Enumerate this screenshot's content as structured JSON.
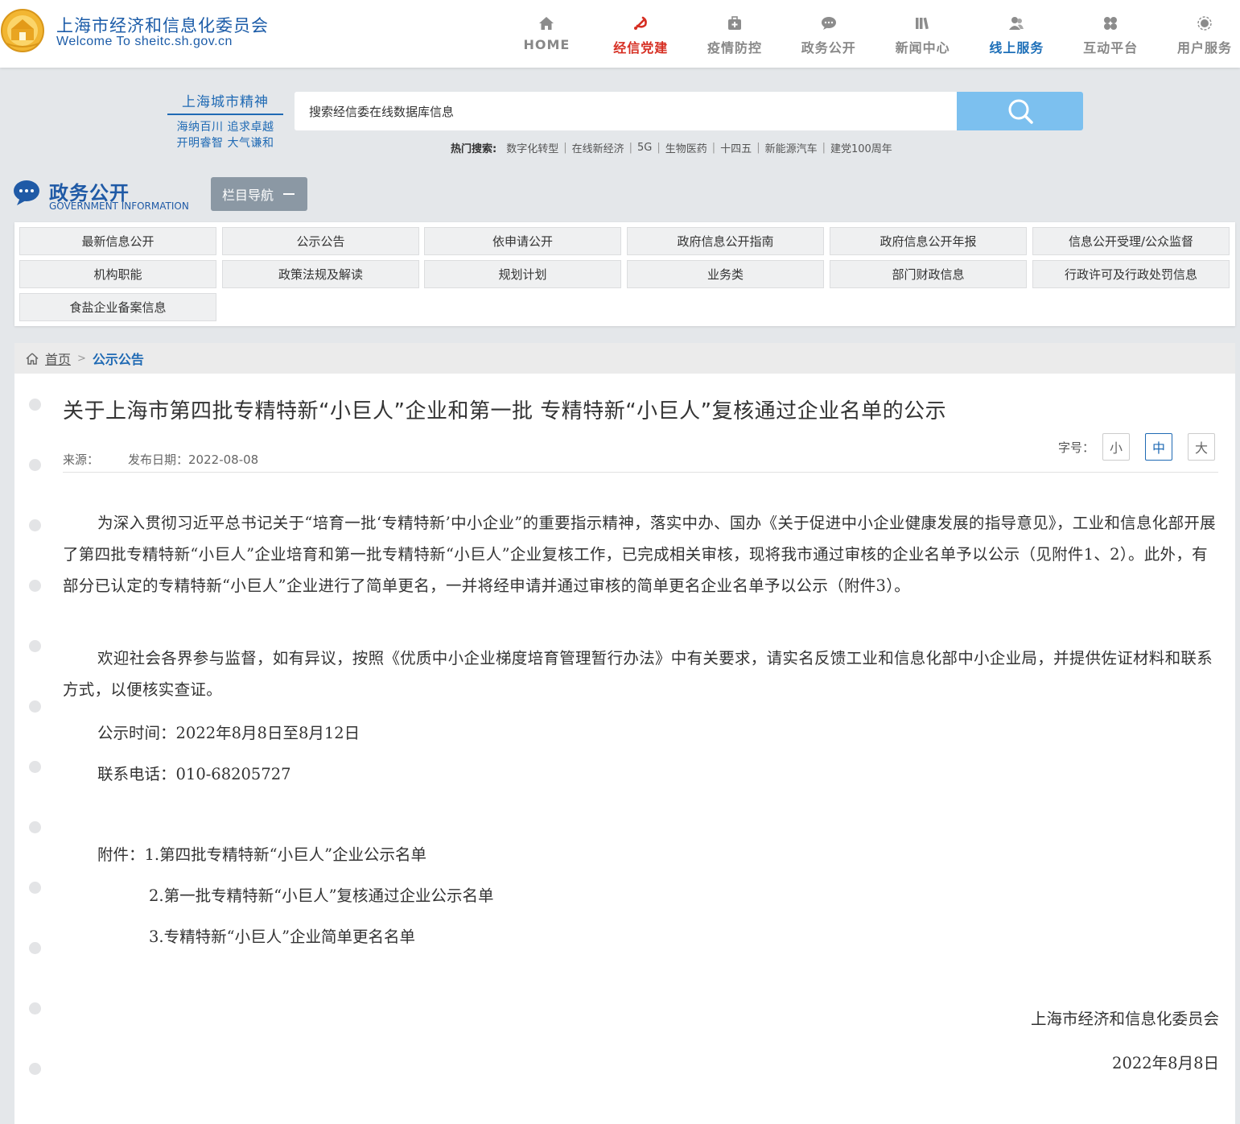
{
  "header": {
    "site_name": "上海市经济和信息化委员会",
    "site_sub": "Welcome  To  sheitc.sh.gov.cn",
    "nav": [
      {
        "label": "HOME",
        "icon": "home-icon"
      },
      {
        "label": "经信党建",
        "icon": "party-emblem-icon"
      },
      {
        "label": "疫情防控",
        "icon": "medical-kit-icon"
      },
      {
        "label": "政务公开",
        "icon": "chat-bubble-icon"
      },
      {
        "label": "新闻中心",
        "icon": "books-icon"
      },
      {
        "label": "线上服务",
        "icon": "users-icon"
      },
      {
        "label": "互动平台",
        "icon": "clover-icon"
      },
      {
        "label": "用户服务",
        "icon": "user-service-icon"
      }
    ]
  },
  "slogan": {
    "title": "上海城市精神",
    "line1": "海纳百川 追求卓越",
    "line2": "开明睿智 大气谦和"
  },
  "search": {
    "value": "搜索经信委在线数据库信息",
    "hot_label": "热门搜索:",
    "hot_items": [
      "数字化转型",
      "在线新经济",
      "5G",
      "生物医药",
      "十四五",
      "新能源汽车",
      "建党100周年"
    ]
  },
  "section": {
    "title": "政务公开",
    "subtitle": "GOVERNMENT INFORMATION",
    "column_nav": "栏目导航"
  },
  "menu": [
    "最新信息公开",
    "公示公告",
    "依申请公开",
    "政府信息公开指南",
    "政府信息公开年报",
    "信息公开受理/公众监督",
    "机构职能",
    "政策法规及解读",
    "规划计划",
    "业务类",
    "部门财政信息",
    "行政许可及行政处罚信息",
    "食盐企业备案信息"
  ],
  "breadcrumb": {
    "home": "首页",
    "sep": ">",
    "current": "公示公告"
  },
  "article": {
    "title": "关于上海市第四批专精特新“小巨人”企业和第一批 专精特新“小巨人”复核通过企业名单的公示",
    "source_label": "来源：",
    "date_label": "发布日期：2022-08-08",
    "font_size_label": "字号：",
    "font_sizes": [
      "小",
      "中",
      "大"
    ],
    "p1": "为深入贯彻习近平总书记关于“培育一批‘专精特新’中小企业”的重要指示精神，落实中办、国办《关于促进中小企业健康发展的指导意见》，工业和信息化部开展了第四批专精特新“小巨人”企业培育和第一批专精特新“小巨人”企业复核工作，已完成相关审核，现将我市通过审核的企业名单予以公示（见附件1、2）。此外，有部分已认定的专精特新“小巨人”企业进行了简单更名，一并将经申请并通过审核的简单更名企业名单予以公示（附件3）。",
    "p2": "欢迎社会各界参与监督，如有异议，按照《优质中小企业梯度培育管理暂行办法》中有关要求，请实名反馈工业和信息化部中小企业局，并提供佐证材料和联系方式，以便核实查证。",
    "period": "公示时间：2022年8月8日至8月12日",
    "phone": "联系电话：010-68205727",
    "attach1": "附件：1.第四批专精特新“小巨人”企业公示名单",
    "attach2": "2.第一批专精特新“小巨人”复核通过企业公示名单",
    "attach3": "3.专精特新“小巨人”企业简单更名名单",
    "sign_org": "上海市经济和信息化委员会",
    "sign_date": "2022年8月8日"
  },
  "colors": {
    "brand_blue": "#1f5aa6",
    "party_red": "#d62e22",
    "search_button": "#7cc0ef",
    "page_bg": "#e4e7ea"
  }
}
